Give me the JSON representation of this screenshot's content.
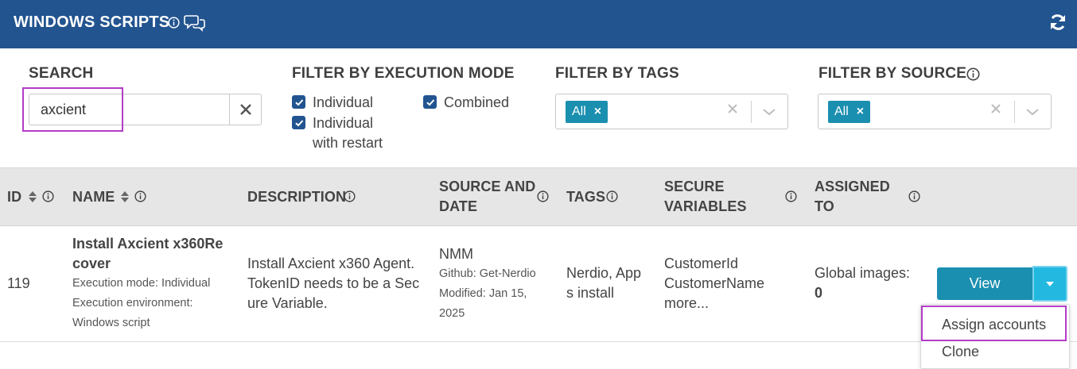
{
  "header": {
    "title": "WINDOWS SCRIPTS",
    "bg_color": "#22548f",
    "icons": [
      "info-icon",
      "chat-icon",
      "refresh-icon"
    ]
  },
  "filters": {
    "search": {
      "label": "SEARCH",
      "value": "axcient"
    },
    "execution_mode": {
      "label": "FILTER BY EXECUTION MODE",
      "options": [
        {
          "label": "Individual",
          "checked": true
        },
        {
          "label": "Individual with restart",
          "label_line1": "Individual",
          "label_line2": "with restart",
          "checked": true
        },
        {
          "label": "Combined",
          "checked": true
        }
      ]
    },
    "tags": {
      "label": "FILTER BY TAGS",
      "selected": "All"
    },
    "source": {
      "label": "FILTER BY SOURCE",
      "selected": "All"
    }
  },
  "table": {
    "columns": {
      "id": "ID",
      "name": "NAME",
      "description": "DESCRIPTION",
      "source_line1": "SOURCE AND",
      "source_line2": "DATE",
      "tags": "TAGS",
      "secure_line1": "SECURE",
      "secure_line2": "VARIABLES",
      "assigned_line1": "ASSIGNED",
      "assigned_line2": "TO"
    },
    "rows": [
      {
        "id": "119",
        "name_line1": "Install Axcient x360Re",
        "name_line2": "cover",
        "execution_mode": "Execution mode: Individual",
        "execution_env_line1": "Execution environment:",
        "execution_env_line2": "Windows script",
        "description_line1": "Install Axcient x360 Agent.",
        "description_line2": "TokenID needs to be a Sec",
        "description_line3": "ure Variable.",
        "source": "NMM",
        "source_repo": "Github: Get-Nerdio",
        "modified_line1": "Modified: Jan 15,",
        "modified_line2": "2025",
        "tags_line1": "Nerdio, App",
        "tags_line2": "s install",
        "secure_vars": [
          "CustomerId",
          "CustomerName"
        ],
        "secure_more": "more...",
        "assigned_label": "Global images:",
        "assigned_count": "0",
        "view_label": "View"
      }
    ]
  },
  "action_menu": {
    "items": [
      "Assign accounts",
      "Clone"
    ]
  },
  "colors": {
    "primary": "#22548f",
    "accent": "#1b8fb0",
    "highlight": "#b43cc8"
  }
}
